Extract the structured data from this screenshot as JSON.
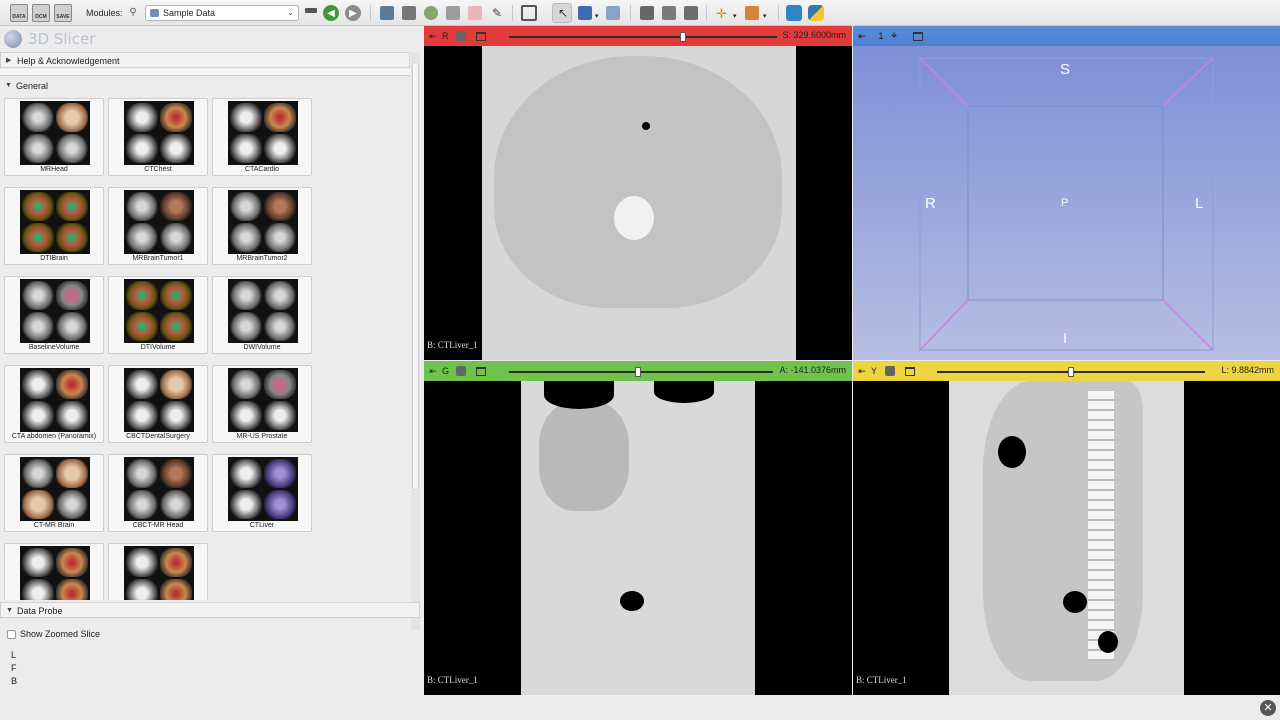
{
  "toolbar": {
    "data_label": "DATA",
    "dcm_label": "DCM",
    "save_label": "SAVE",
    "modules_label": "Modules:",
    "module_selected": "Sample Data"
  },
  "app": {
    "logo_text": "3D Slicer"
  },
  "sections": {
    "help": "Help & Acknowledgement",
    "general": "General",
    "data_probe": "Data Probe"
  },
  "datasets": [
    {
      "label": "MRHead",
      "colors": [
        "g1",
        "g2",
        "g1",
        "g1"
      ]
    },
    {
      "label": "CTChest",
      "colors": [
        "g8",
        "g3",
        "g8",
        "g8"
      ]
    },
    {
      "label": "CTACardio",
      "colors": [
        "g8",
        "g3",
        "g8",
        "g8"
      ]
    },
    {
      "label": "DTIBrain",
      "colors": [
        "g4",
        "g4",
        "g4",
        "g4"
      ]
    },
    {
      "label": "MRBrainTumor1",
      "colors": [
        "g1",
        "g5",
        "g1",
        "g1"
      ]
    },
    {
      "label": "MRBrainTumor2",
      "colors": [
        "g1",
        "g5",
        "g1",
        "g1"
      ]
    },
    {
      "label": "BaselineVolume",
      "colors": [
        "g1",
        "g6",
        "g1",
        "g1"
      ]
    },
    {
      "label": "DTIVolume",
      "colors": [
        "g4",
        "g4",
        "g4",
        "g4"
      ]
    },
    {
      "label": "DWIVolume",
      "colors": [
        "g1",
        "g1",
        "g1",
        "g1"
      ]
    },
    {
      "label": "CTA abdomen (Panoramix)",
      "colors": [
        "g8",
        "g3",
        "g8",
        "g8"
      ]
    },
    {
      "label": "CBCTDentalSurgery",
      "colors": [
        "g8",
        "g2",
        "g8",
        "g8"
      ]
    },
    {
      "label": "MR-US Prostate",
      "colors": [
        "g1",
        "g6",
        "g8",
        "g8"
      ]
    },
    {
      "label": "CT-MR Brain",
      "colors": [
        "g1",
        "g2",
        "g2",
        "g1"
      ]
    },
    {
      "label": "CBCT-MR Head",
      "colors": [
        "g1",
        "g5",
        "g1",
        "g1"
      ]
    },
    {
      "label": "CTLiver",
      "colors": [
        "g8",
        "g7",
        "g8",
        "g7"
      ]
    },
    {
      "label": "",
      "colors": [
        "g8",
        "g3",
        "g8",
        "g3"
      ]
    },
    {
      "label": "",
      "colors": [
        "g8",
        "g3",
        "g8",
        "g3"
      ]
    }
  ],
  "data_probe": {
    "show_zoomed_slice": "Show Zoomed Slice",
    "checked": false,
    "coords": [
      "L",
      "F",
      "B"
    ]
  },
  "views": {
    "red": {
      "name": "R",
      "offset": "S: 329.6000mm",
      "slider": 0.65,
      "background": "B: CTLiver_1"
    },
    "threed": {
      "name": "1",
      "labels": {
        "top": "S",
        "left": "R",
        "right": "L",
        "center": "P",
        "bottom": "I"
      }
    },
    "green": {
      "name": "G",
      "offset": "A: -141.0376mm",
      "slider": 0.49,
      "background": "B: CTLiver_1"
    },
    "yellow": {
      "name": "Y",
      "offset": "L: 9.8842mm",
      "slider": 0.5,
      "background": "B: CTLiver_1"
    }
  },
  "colors": {
    "red": "#e23b3b",
    "green": "#6fc24b",
    "yellow": "#ecd541",
    "blue": "#5b8ed9",
    "box_edge": "#d77be8"
  }
}
